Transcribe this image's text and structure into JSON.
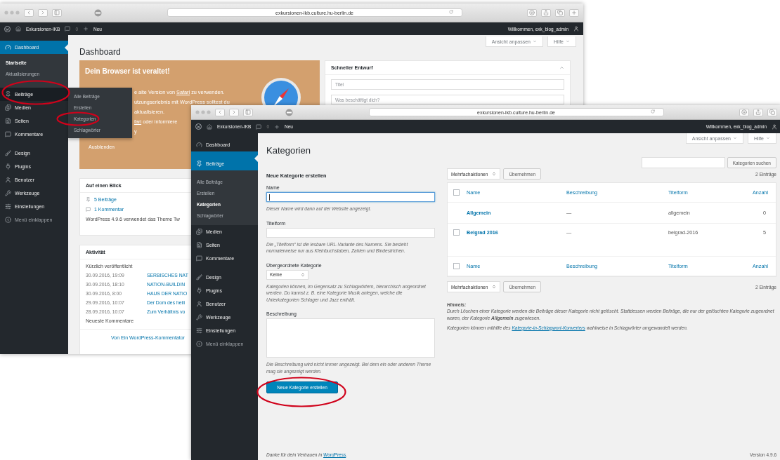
{
  "back_window": {
    "browser": {
      "url": "exkursionen-ikb.culture.hu-berlin.de"
    },
    "admin_bar": {
      "site": "Exkursionen-IKB",
      "comments": "0",
      "new": "Neu",
      "greeting": "Willkommen, exk_blog_admin"
    },
    "sidebar": [
      {
        "label": "Dashboard",
        "kind": "menu",
        "selected": true,
        "children": [
          {
            "label": "Startseite",
            "selected": true
          },
          {
            "label": "Aktualisierungen",
            "selected": false
          }
        ]
      },
      {
        "label": "Beiträge",
        "kind": "menu",
        "selected": false,
        "flyout": [
          "Alle Beiträge",
          "Erstellen",
          "Kategorien",
          "Schlagwörter"
        ]
      },
      {
        "label": "Medien",
        "kind": "menu",
        "selected": false
      },
      {
        "label": "Seiten",
        "kind": "menu",
        "selected": false
      },
      {
        "label": "Kommentare",
        "kind": "menu",
        "selected": false
      },
      {
        "label": "Design",
        "kind": "menu",
        "selected": false,
        "gap_before": true
      },
      {
        "label": "Plugins",
        "kind": "menu",
        "selected": false
      },
      {
        "label": "Benutzer",
        "kind": "menu",
        "selected": false
      },
      {
        "label": "Werkzeuge",
        "kind": "menu",
        "selected": false
      },
      {
        "label": "Einstellungen",
        "kind": "menu",
        "selected": false
      },
      {
        "label": "Menü einklappen",
        "kind": "collapse",
        "selected": false
      }
    ],
    "screen_options": "Ansicht anpassen",
    "help": "Hilfe",
    "title": "Dashboard",
    "notice": {
      "title": "Dein Browser ist veraltet!",
      "lines": [
        [
          {
            "text": "e alte Version von ",
            "link": false
          },
          {
            "text": "Safari",
            "link": true
          },
          {
            "text": " zu verwenden.",
            "link": false
          }
        ],
        [
          {
            "text": "utzungserlebnis mit WordPress solltest du",
            "link": false
          }
        ],
        [
          {
            "text": "aktualisieren.",
            "link": false
          }
        ],
        [
          {
            "text": "fari",
            "link": true
          },
          {
            "text": " oder informiere",
            "link": false
          }
        ],
        [
          {
            "text": "y",
            "link": false
          }
        ]
      ],
      "dismiss": "Ausblenden"
    },
    "glance": {
      "title": "Auf einen Blick",
      "items": [
        "5 Beiträge",
        "1 Kommentar"
      ],
      "footer": "WordPress 4.9.6 verwendet das Theme Tw"
    },
    "activity": {
      "title": "Aktivität",
      "subtitle": "Kürzlich veröffentlicht",
      "posts": [
        {
          "date": "30.09.2016, 19:09",
          "title": "SERBISCHES NAT"
        },
        {
          "date": "30.09.2016, 18:10",
          "title": "NATION-BUILDIN"
        },
        {
          "date": "30.09.2016, 8:00",
          "title": "HAUS DER NATIO"
        },
        {
          "date": "29.09.2016, 10:07",
          "title": "Der Dom des heili"
        },
        {
          "date": "28.09.2016, 10:07",
          "title": "Zum Verhältnis vo"
        }
      ],
      "comments_title": "Neueste Kommentare",
      "comment": "Von Ein WordPress-Kommentator"
    },
    "quick_draft": {
      "title": "Schneller Entwurf",
      "title_placeholder": "Titel",
      "content_placeholder": "Was beschäftigt dich?"
    }
  },
  "front_window": {
    "browser": {
      "url": "exkursionen-ikb.culture.hu-berlin.de"
    },
    "admin_bar": {
      "site": "Exkursionen-IKB",
      "comments": "0",
      "new": "Neu",
      "greeting": "Willkommen, exk_blog_admin"
    },
    "sidebar": [
      {
        "label": "Dashboard",
        "kind": "menu",
        "selected": false
      },
      {
        "label": "Beiträge",
        "kind": "menu",
        "selected": true,
        "gap_before": true,
        "children": [
          {
            "label": "Alle Beiträge",
            "selected": false
          },
          {
            "label": "Erstellen",
            "selected": false
          },
          {
            "label": "Kategorien",
            "selected": true
          },
          {
            "label": "Schlagwörter",
            "selected": false
          }
        ]
      },
      {
        "label": "Medien",
        "kind": "menu",
        "selected": false
      },
      {
        "label": "Seiten",
        "kind": "menu",
        "selected": false
      },
      {
        "label": "Kommentare",
        "kind": "menu",
        "selected": false
      },
      {
        "label": "Design",
        "kind": "menu",
        "selected": false,
        "gap_before": true
      },
      {
        "label": "Plugins",
        "kind": "menu",
        "selected": false
      },
      {
        "label": "Benutzer",
        "kind": "menu",
        "selected": false
      },
      {
        "label": "Werkzeuge",
        "kind": "menu",
        "selected": false
      },
      {
        "label": "Einstellungen",
        "kind": "menu",
        "selected": false
      },
      {
        "label": "Menü einklappen",
        "kind": "collapse",
        "selected": false
      }
    ],
    "screen_options": "Ansicht anpassen",
    "help": "Hilfe",
    "title": "Kategorien",
    "search": {
      "button": "Kategorien suchen"
    },
    "form": {
      "heading": "Neue Kategorie erstellen",
      "fields": [
        {
          "label": "Name",
          "kind": "input",
          "focused": true,
          "hint": "Dieser Name wird dann auf der Website angezeigt."
        },
        {
          "label": "Titelform",
          "kind": "input",
          "focused": false,
          "hint": "Die „Titelform“ ist die lesbare URL-Variante des Namens. Sie besteht normalerweise nur aus Kleinbuchstaben, Zahlen und Bindestrichen."
        },
        {
          "label": "Übergeordnete Kategorie",
          "kind": "select",
          "value": "Keine",
          "hint": "Kategorien können, im Gegensatz zu Schlagwörtern, hierarchisch angeordnet werden. Du kannst z. B. eine Kategorie Musik anlegen, welche die Unterkategorien Schlager und Jazz enthält."
        },
        {
          "label": "Beschreibung",
          "kind": "textarea",
          "hint": "Die Beschreibung wird nicht immer angezeigt. Bei dem ein oder anderen Theme mag sie angezeigt werden."
        }
      ],
      "submit": "Neue Kategorie erstellen"
    },
    "table": {
      "top_bar": {
        "bulk_action": "Mehrfachaktionen",
        "apply": "Übernehmen",
        "count": "2 Einträge"
      },
      "columns": [
        "Name",
        "Beschreibung",
        "Titelform",
        "Anzahl"
      ],
      "header_checked": false,
      "rows": [
        {
          "name": "Allgemein",
          "description": "—",
          "slug": "allgemein",
          "count": "0"
        },
        {
          "name": "Belgrad 2016",
          "description": "—",
          "slug": "belgrad-2016",
          "count": "5",
          "checked": false
        }
      ],
      "footer_columns": [
        "Name",
        "Beschreibung",
        "Titelform",
        "Anzahl"
      ],
      "footer_checked": false,
      "bottom_bar": {
        "bulk_action": "Mehrfachaktionen",
        "apply": "Übernehmen",
        "count": "2 Einträge"
      }
    },
    "note": {
      "title": "Hinweis:",
      "text": "Durch Löschen einer Kategorie werden die Beiträge dieser Kategorie nicht gelöscht. Stattdessen werden Beiträge, die nur der gelöschten Kategorie zugeordnet waren, der Kategorie **Allgemein** zugewiesen.",
      "converter": {
        "before": "Kategorien können mithilfe des ",
        "link": "Kategorie-in-Schlagwort-Konverters",
        "after": " wahlweise in Schlagwörter umgewandelt werden."
      }
    },
    "footer": {
      "before": "Danke für dein Vertrauen in ",
      "link": "WordPress",
      "after": "."
    },
    "version": "Version 4.9.6"
  }
}
